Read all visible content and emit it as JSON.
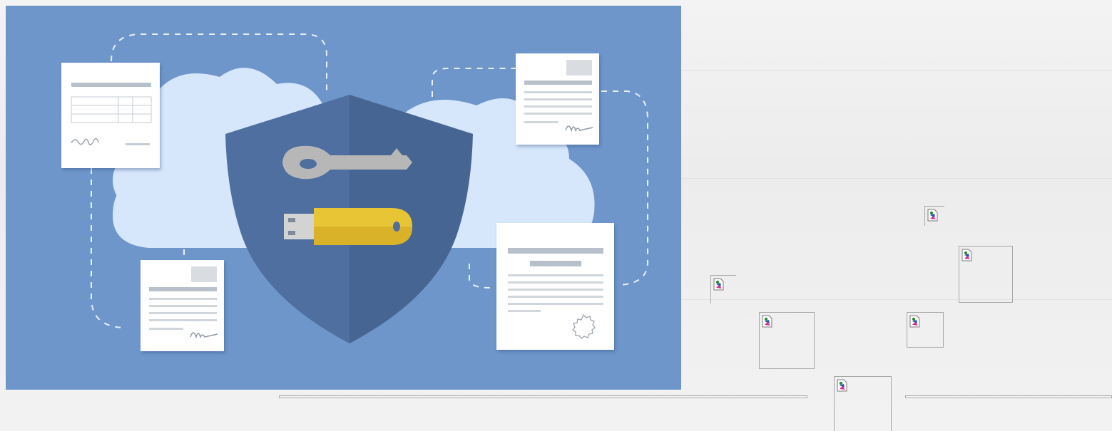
{
  "hero_image": {
    "alt": "",
    "icons": [
      "cloud-icon",
      "shield-icon",
      "key-icon",
      "usb-key-icon",
      "document-icon",
      "certificate-icon"
    ]
  },
  "broken_images": [
    {
      "name": "broken-image-1",
      "icon": "broken-image-icon"
    },
    {
      "name": "broken-image-2",
      "icon": "broken-image-icon"
    },
    {
      "name": "broken-image-3",
      "icon": "broken-image-icon"
    },
    {
      "name": "broken-image-4",
      "icon": "broken-image-icon"
    },
    {
      "name": "broken-image-5",
      "icon": "broken-image-icon"
    },
    {
      "name": "broken-image-6",
      "icon": "broken-image-icon"
    }
  ],
  "colors": {
    "hero_background": "#6e96cb",
    "cloud": "#d6e6fb",
    "shield_left": "#4e6f9f",
    "shield_right": "#466592",
    "key": "#b7b7b7",
    "usb_key": "#e8c534",
    "page_background": "#efefef"
  }
}
